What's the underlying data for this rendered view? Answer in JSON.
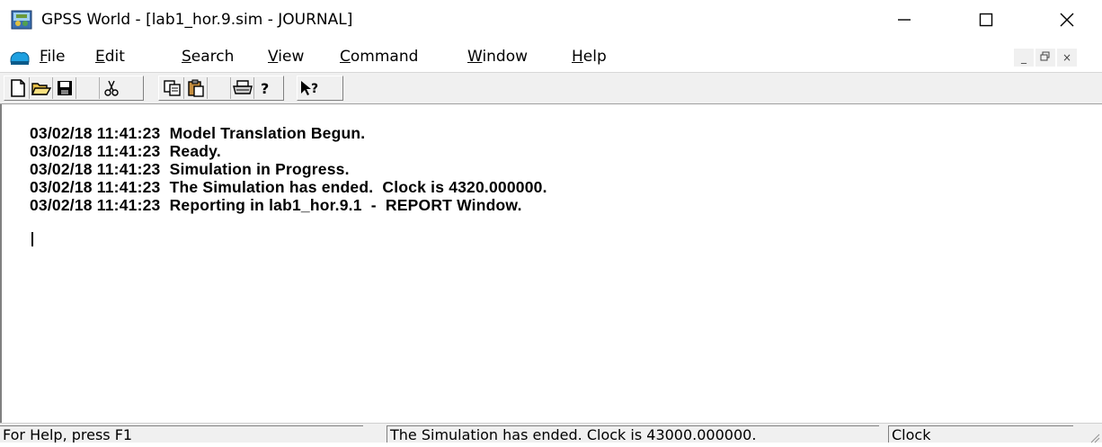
{
  "window": {
    "title": "GPSS World - [lab1_hor.9.sim  -  JOURNAL]",
    "app_icon": "gpss-world-icon",
    "controls": [
      "minimize-icon",
      "maximize-icon",
      "close-icon"
    ]
  },
  "menubar": {
    "doc_icon": "journal-doc-icon",
    "items": [
      {
        "accel": "F",
        "rest": "ile"
      },
      {
        "accel": "E",
        "rest": "dit"
      },
      {
        "accel": "S",
        "rest": "earch"
      },
      {
        "accel": "V",
        "rest": "iew"
      },
      {
        "accel": "C",
        "rest": "ommand"
      },
      {
        "accel": "W",
        "rest": "indow"
      },
      {
        "accel": "H",
        "rest": "elp"
      }
    ],
    "mdi_controls": {
      "minimize": "_",
      "restore": "ɩ",
      "close": "×"
    }
  },
  "toolbar": {
    "buttons": [
      "new-file-icon",
      "open-folder-icon",
      "save-disk-icon",
      "cut-scissors-icon",
      "copy-icon",
      "paste-clipboard-icon",
      "print-icon",
      "help-icon",
      "context-help-icon"
    ]
  },
  "journal": {
    "lines": [
      "03/02/18 11:41:23  Model Translation Begun.",
      "03/02/18 11:41:23  Ready.",
      "03/02/18 11:41:23  Simulation in Progress.",
      "03/02/18 11:41:23  The Simulation has ended.  Clock is 4320.000000.",
      "03/02/18 11:41:23  Reporting in lab1_hor.9.1  -  REPORT Window."
    ]
  },
  "statusbar": {
    "help_text": "For Help, press F1",
    "message": "The Simulation has ended.  Clock is 43000.000000.",
    "clock_label": "Clock"
  }
}
